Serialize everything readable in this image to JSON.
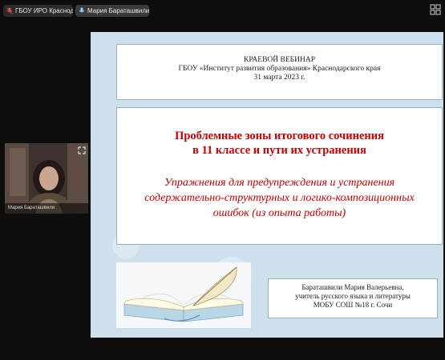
{
  "topbar": {
    "participants": [
      {
        "name": "ГБОУ ИРО Краснод..."
      },
      {
        "name": "Мария Бараташвили"
      }
    ]
  },
  "slide": {
    "header": {
      "line1": "КРАЕВОЙ  ВЕБИНАР",
      "line2": "ГБОУ «Институт развития образования» Краснодарского края",
      "line3": "31 марта 2023  г."
    },
    "title": {
      "line1": "Проблемные зоны итогового сочинения",
      "line2": "в 11 классе и пути их устранения"
    },
    "subtitle": {
      "line1": "Упражнения для предупреждения и устранения",
      "line2": "содержательно-структурных и логико-композиционных",
      "line3": "ошибок (из опыта работы)"
    },
    "author": {
      "line1": "Бараташвили Мария Валерьевна,",
      "line2": "учитель русского языка и литературы",
      "line3": "МОБУ СОШ №18 г. Сочи"
    }
  },
  "video": {
    "name": "Мария Бараташвили"
  },
  "colors": {
    "title_red": "#c00000",
    "slide_bg": "#cde0ec",
    "app_bg": "#0d0d0d"
  }
}
